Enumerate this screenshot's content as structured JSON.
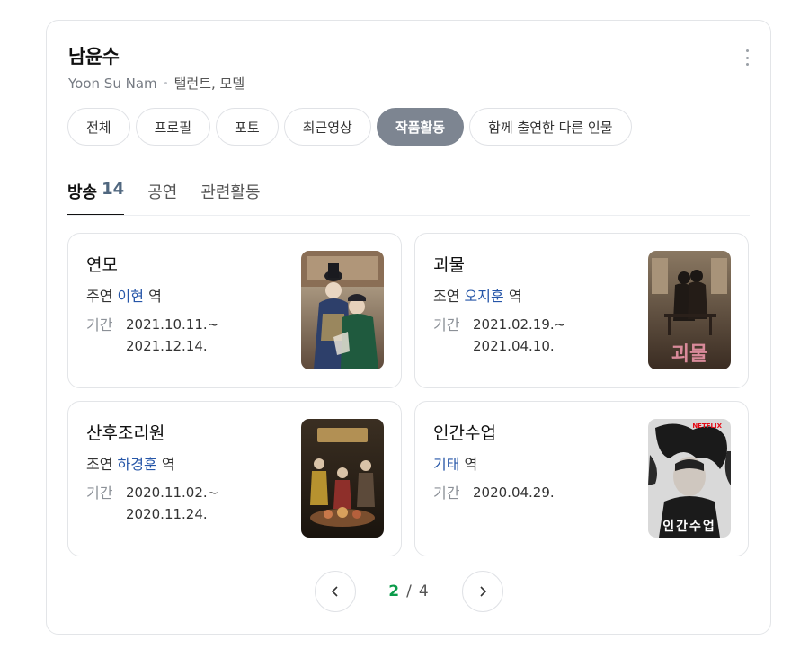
{
  "profile": {
    "name": "남윤수",
    "english_name": "Yoon Su Nam",
    "occupation": "탤런트, 모델",
    "more_icon": "more-vertical-icon"
  },
  "tabs": [
    {
      "label": "전체",
      "active": false
    },
    {
      "label": "프로필",
      "active": false
    },
    {
      "label": "포토",
      "active": false
    },
    {
      "label": "최근영상",
      "active": false
    },
    {
      "label": "작품활동",
      "active": true
    },
    {
      "label": "함께 출연한 다른 인물",
      "active": false
    }
  ],
  "subtabs": [
    {
      "label": "방송",
      "count": "14",
      "active": true
    },
    {
      "label": "공연",
      "active": false
    },
    {
      "label": "관련활동",
      "active": false
    }
  ],
  "works": [
    {
      "title": "연모",
      "role_type": "주연",
      "character": "이현",
      "role_suffix": "역",
      "period_label": "기간",
      "period_start": "2021.10.11.~",
      "period_end": "2021.12.14."
    },
    {
      "title": "괴물",
      "role_type": "조연",
      "character": "오지훈",
      "role_suffix": "역",
      "period_label": "기간",
      "period_start": "2021.02.19.~",
      "period_end": "2021.04.10."
    },
    {
      "title": "산후조리원",
      "role_type": "조연",
      "character": "하경훈",
      "role_suffix": "역",
      "period_label": "기간",
      "period_start": "2020.11.02.~",
      "period_end": "2020.11.24."
    },
    {
      "title": "인간수업",
      "role_type": "",
      "character": "기태",
      "role_suffix": "역",
      "period_label": "기간",
      "period_start": "2020.04.29.",
      "period_end": ""
    }
  ],
  "posters": {
    "goemul_text": "괴물",
    "human_class_text": "인간수업",
    "human_class_badge": "NETFLIX"
  },
  "pagination": {
    "current": "2",
    "separator": "/",
    "total": "4",
    "prev_icon": "chevron-left-icon",
    "next_icon": "chevron-right-icon"
  },
  "colors": {
    "active_chip": "#7d8591",
    "character_link": "#2656a8",
    "current_page": "#0b9b4a",
    "count": "#50677f"
  }
}
